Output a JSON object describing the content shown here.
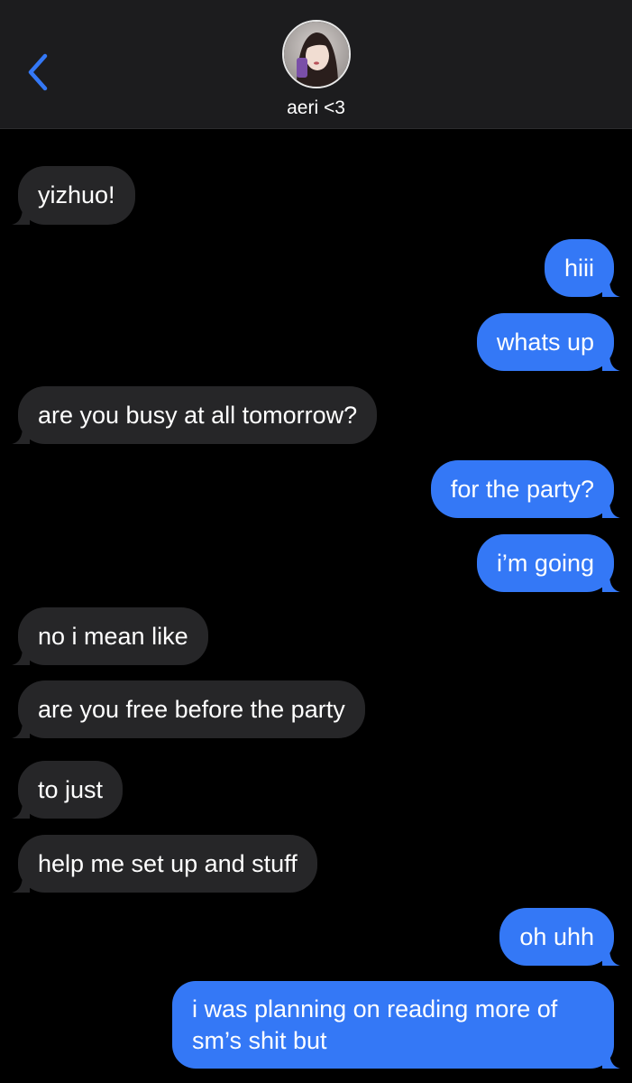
{
  "header": {
    "back_icon": "chevron-left-icon",
    "contact_name": "aeri <3",
    "accent_color": "#3478f6"
  },
  "messages": [
    {
      "direction": "incoming",
      "text": "yizhuo!"
    },
    {
      "direction": "outgoing",
      "text": "hiii"
    },
    {
      "direction": "outgoing",
      "text": "whats up"
    },
    {
      "direction": "incoming",
      "text": "are you busy at all tomorrow?"
    },
    {
      "direction": "outgoing",
      "text": "for the party?"
    },
    {
      "direction": "outgoing",
      "text": "i’m going"
    },
    {
      "direction": "incoming",
      "text": "no i mean like"
    },
    {
      "direction": "incoming",
      "text": "are you free before the party"
    },
    {
      "direction": "incoming",
      "text": "to just"
    },
    {
      "direction": "incoming",
      "text": "help me set up and stuff"
    },
    {
      "direction": "outgoing",
      "text": "oh uhh"
    },
    {
      "direction": "outgoing",
      "text": "i was planning on reading more of sm’s shit but"
    }
  ],
  "colors": {
    "incoming_bubble": "#262628",
    "outgoing_bubble": "#3478f6",
    "background": "#000000",
    "header_background": "#1c1c1e"
  }
}
